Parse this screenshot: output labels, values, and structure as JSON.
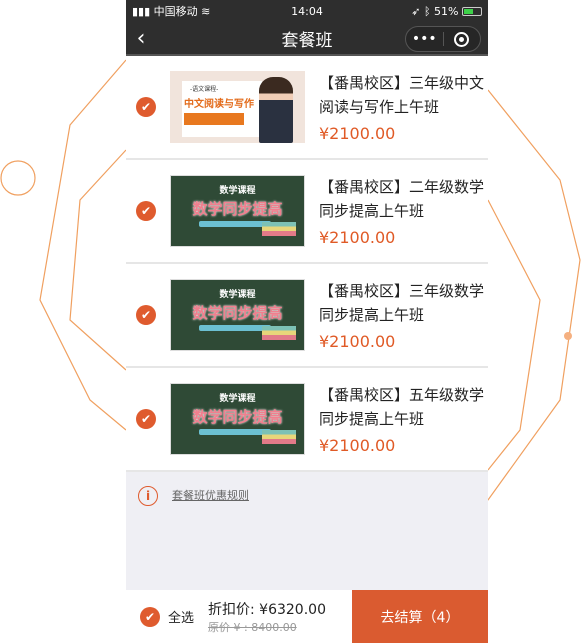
{
  "status_bar": {
    "carrier": "中国移动",
    "time": "14:04",
    "battery": "51%"
  },
  "nav": {
    "title": "套餐班",
    "more": "•••"
  },
  "items": [
    {
      "name": "【番禺校区】三年级中文阅读与写作上午班",
      "price": "¥2100.00",
      "thumb_title": "-语文课程-",
      "thumb_main": "中文阅读与写作"
    },
    {
      "name": "【番禺校区】二年级数学同步提高上午班",
      "price": "¥2100.00",
      "thumb_title": "数学课程",
      "thumb_main": "数学同步提高"
    },
    {
      "name": "【番禺校区】三年级数学同步提高上午班",
      "price": "¥2100.00",
      "thumb_title": "数学课程",
      "thumb_main": "数学同步提高"
    },
    {
      "name": "【番禺校区】五年级数学同步提高上午班",
      "price": "¥2100.00",
      "thumb_title": "数学课程",
      "thumb_main": "数学同步提高"
    }
  ],
  "rules_link": "套餐班优惠规则",
  "footer": {
    "select_all": "全选",
    "discount": "折扣价: ¥6320.00",
    "original": "原价 ¥ : 8400.00",
    "checkout": "去结算（4）"
  },
  "colors": {
    "accent": "#df5b2e"
  }
}
